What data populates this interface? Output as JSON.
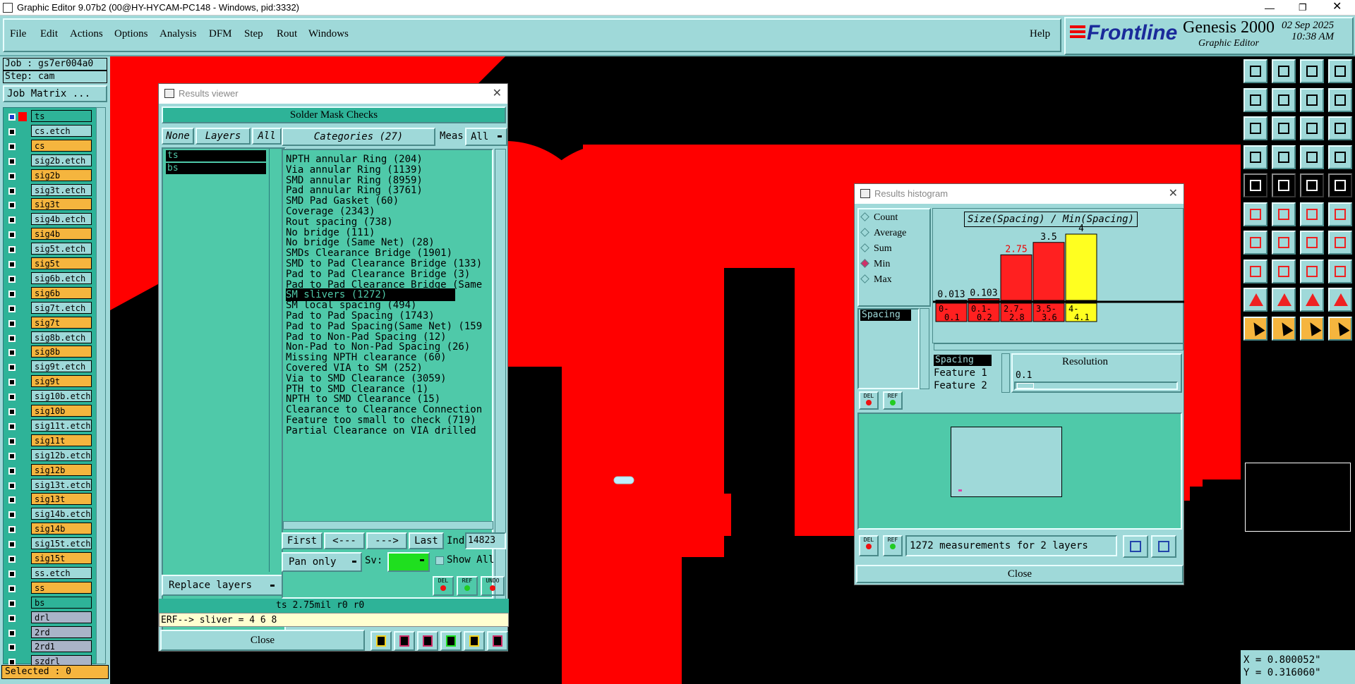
{
  "window": {
    "title": "Graphic Editor 9.07b2 (00@HY-HYCAM-PC148 - Windows, pid:3332)"
  },
  "menu": {
    "items": [
      "File",
      "Edit",
      "Actions",
      "Options",
      "Analysis",
      "DFM",
      "Step",
      "Rout",
      "Windows"
    ],
    "help": "Help"
  },
  "brand": {
    "logo": "Frontline",
    "product": "Genesis 2000",
    "subtitle": "Graphic Editor",
    "date": "02 Sep 2025",
    "time": "10:38 AM"
  },
  "job": {
    "job": "Job : gs7er004a0",
    "step": "Step: cam",
    "matrix_button": "Job Matrix ...",
    "selected": "Selected : 0"
  },
  "layers": [
    {
      "name": "ts",
      "color": "#2eb398"
    },
    {
      "name": "cs.etch",
      "color": "#9fd9d9"
    },
    {
      "name": "cs",
      "color": "#f5b53e"
    },
    {
      "name": "sig2b.etch",
      "color": "#9fd9d9"
    },
    {
      "name": "sig2b",
      "color": "#f5b53e"
    },
    {
      "name": "sig3t.etch",
      "color": "#9fd9d9"
    },
    {
      "name": "sig3t",
      "color": "#f5b53e"
    },
    {
      "name": "sig4b.etch",
      "color": "#9fd9d9"
    },
    {
      "name": "sig4b",
      "color": "#f5b53e"
    },
    {
      "name": "sig5t.etch",
      "color": "#9fd9d9"
    },
    {
      "name": "sig5t",
      "color": "#f5b53e"
    },
    {
      "name": "sig6b.etch",
      "color": "#9fd9d9"
    },
    {
      "name": "sig6b",
      "color": "#f5b53e"
    },
    {
      "name": "sig7t.etch",
      "color": "#9fd9d9"
    },
    {
      "name": "sig7t",
      "color": "#f5b53e"
    },
    {
      "name": "sig8b.etch",
      "color": "#9fd9d9"
    },
    {
      "name": "sig8b",
      "color": "#f5b53e"
    },
    {
      "name": "sig9t.etch",
      "color": "#9fd9d9"
    },
    {
      "name": "sig9t",
      "color": "#f5b53e"
    },
    {
      "name": "sig10b.etch",
      "color": "#9fd9d9"
    },
    {
      "name": "sig10b",
      "color": "#f5b53e"
    },
    {
      "name": "sig11t.etch",
      "color": "#9fd9d9"
    },
    {
      "name": "sig11t",
      "color": "#f5b53e"
    },
    {
      "name": "sig12b.etch",
      "color": "#9fd9d9"
    },
    {
      "name": "sig12b",
      "color": "#f5b53e"
    },
    {
      "name": "sig13t.etch",
      "color": "#9fd9d9"
    },
    {
      "name": "sig13t",
      "color": "#f5b53e"
    },
    {
      "name": "sig14b.etch",
      "color": "#9fd9d9"
    },
    {
      "name": "sig14b",
      "color": "#f5b53e"
    },
    {
      "name": "sig15t.etch",
      "color": "#9fd9d9"
    },
    {
      "name": "sig15t",
      "color": "#f5b53e"
    },
    {
      "name": "ss.etch",
      "color": "#9fd9d9"
    },
    {
      "name": "ss",
      "color": "#f5b53e"
    },
    {
      "name": "bs",
      "color": "#2eb398"
    },
    {
      "name": "drl",
      "color": "#a9b4c8"
    },
    {
      "name": "2rd",
      "color": "#a9b4c8"
    },
    {
      "name": "2rd1",
      "color": "#a9b4c8"
    },
    {
      "name": "szdrl",
      "color": "#a9b4c8"
    }
  ],
  "results_viewer": {
    "title": "Results viewer",
    "header": "Solder Mask Checks",
    "none_btn": "None",
    "layers_btn": "Layers",
    "all_btn": "All",
    "layer_list": [
      "ts",
      "bs"
    ],
    "categories_btn": "Categories (27)",
    "meas_label": "Meas:",
    "meas_value": "All",
    "categories": [
      "NPTH annular Ring (204)",
      "Via annular Ring (1139)",
      "SMD annular Ring (8959)",
      "Pad annular Ring (3761)",
      "SMD Pad Gasket (60)",
      "Coverage (2343)",
      "Rout spacing (738)",
      "No bridge (111)",
      "No bridge (Same Net) (28)",
      "SMDs Clearance Bridge (1901)",
      "SMD to Pad Clearance Bridge (133)",
      "Pad to Pad Clearance Bridge (3)",
      "Pad to Pad Clearance Bridge (Same",
      "SM slivers (1272)",
      "SM local spacing (494)",
      "Pad to Pad Spacing (1743)",
      "Pad to Pad Spacing(Same Net) (159",
      "Pad to Non-Pad Spacing (12)",
      "Non-Pad to Non-Pad Spacing (26)",
      "Missing NPTH clearance (60)",
      "Covered VIA to SM (252)",
      "Via to SMD Clearance (3059)",
      "PTH to SMD Clearance (1)",
      "NPTH to SMD Clearance (15)",
      "Clearance to Clearance Connection",
      "Feature too small to check (719)",
      "Partial Clearance on VIA drilled"
    ],
    "selected_index": 13,
    "first": "First",
    "prev": "<---",
    "next": "--->",
    "last": "Last",
    "index_label": "Index:",
    "index_value": "14823",
    "pan_only": "Pan only",
    "sv_label": "Sv:",
    "show_all": "Show All",
    "replace_layers": "Replace layers",
    "status": "ts 2.75mil  r0  r0",
    "erf": "ERF--> sliver = 4 6 8",
    "close": "Close",
    "del": "DEL",
    "ref": "REF",
    "undo": "UNDO"
  },
  "histogram": {
    "title": "Results histogram",
    "modes": [
      "Count",
      "Average",
      "Sum",
      "Min",
      "Max"
    ],
    "selected_mode": "Min",
    "attr_list": [
      "Spacing"
    ],
    "chart_title": "Size(Spacing) / Min(Spacing)",
    "feature_list": [
      "Spacing",
      "Feature 1",
      "Feature 2"
    ],
    "resolution_label": "Resolution",
    "resolution_value": "0.1",
    "summary": "1272 measurements for 2 layers",
    "close": "Close",
    "del": "DEL",
    "ref": "REF"
  },
  "chart_data": {
    "type": "bar",
    "title": "Size(Spacing) / Min(Spacing)",
    "categories": [
      "0-0.1",
      "0.1-0.2",
      "2.7-2.8",
      "3.5-3.6",
      "4-4.1"
    ],
    "values": [
      0.013,
      0.103,
      2.75,
      3.5,
      4
    ],
    "value_labels": [
      "0.013",
      "0.103",
      "2.75",
      "3.5",
      "4"
    ],
    "colors": [
      "#ff2020",
      "#ff2020",
      "#ff2020",
      "#ff2020",
      "#ffff20"
    ],
    "ylim": [
      0,
      4
    ]
  },
  "coords": {
    "x": "X = 0.800052\"",
    "y": "Y = 0.316060\""
  }
}
